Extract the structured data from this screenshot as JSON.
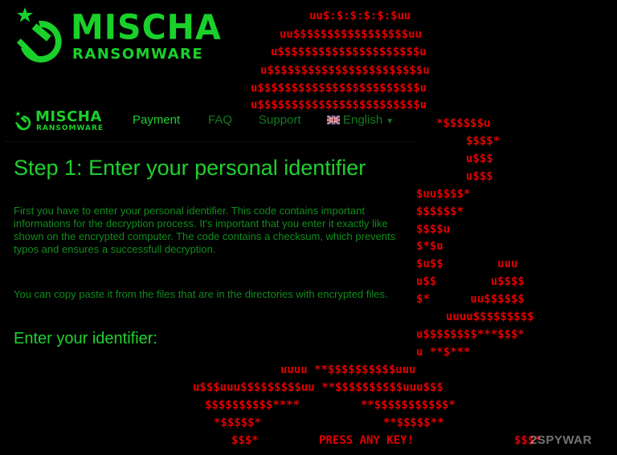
{
  "logo": {
    "line1": "MISCHA",
    "line2": "RANSOMWARE"
  },
  "nav": {
    "payment": "Payment",
    "faq": "FAQ",
    "support": "Support",
    "language": "English"
  },
  "content": {
    "heading": "Step 1: Enter your personal identifier",
    "paragraph1": "First you have to enter your personal identifier. This code contains important informations for the decryption process. It's important that you enter it exactly like shown on the encrypted computer. The code contains a checksum, which prevents typos and ensures a successfull decryption.",
    "paragraph2": "You can copy paste it from the files that are in the directories with encrypted files.",
    "identifier_label": "Enter your identifier:"
  },
  "ascii_art": [
    "uu$:$:$:$:$:$uu",
    "uu$$$$$$$$$$$$$$$$$uu",
    "u$$$$$$$$$$$$$$$$$$$$$u",
    "u$$$$$$$$$$$$$$$$$$$$$$$u",
    "u$$$$$$$$$$$$$$$$$$$$$$$$u",
    "u$$$$$$$$$$$$$$$$$$$$$$$$u",
    "*$$$$$$u",
    "$$$$*",
    "u$$$",
    "u$$$",
    "$uu$$$$*",
    "$$$$$$*",
    "$$$$u",
    "$*$u",
    "$u$$        uuu",
    "u$$        u$$$$",
    "$*      uu$$$$$$",
    "uuuu$$$$$$$$$",
    "u$$$$$$$$***$$$*",
    "u **$***",
    "uuuu **$$$$$$$$$$uuu",
    "u$$$uuu$$$$$$$$$uu **$$$$$$$$$$uuu$$$",
    "$$$$$$$$$$****         **$$$$$$$$$$$*",
    "*$$$$$*                  **$$$$$**",
    "$$$*",
    "$$$*"
  ],
  "press_text": "PRESS ANY KEY!",
  "watermark": "2SPYWAR",
  "colors": {
    "accent_green": "#19d12a",
    "ascii_red": "#e00000",
    "background": "#000000"
  },
  "icons": [
    "hammer-sickle-icon",
    "star-icon",
    "uk-flag-icon",
    "chevron-down-icon"
  ]
}
